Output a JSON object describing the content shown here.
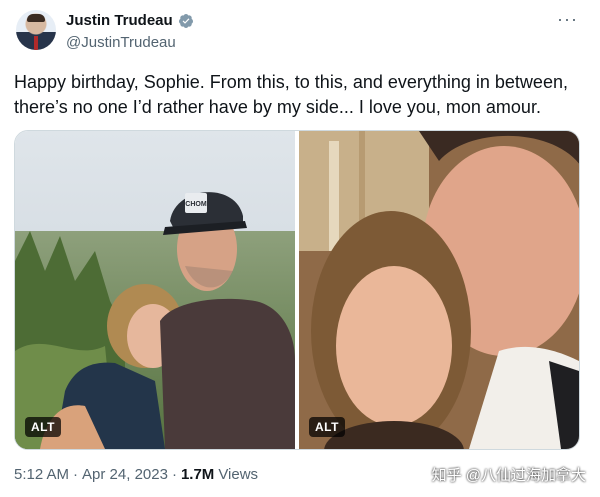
{
  "author": {
    "display_name": "Justin Trudeau",
    "handle": "@JustinTrudeau",
    "verified_icon": "verified-badge-icon"
  },
  "more_menu": {
    "label": "···",
    "icon": "more-options-icon"
  },
  "tweet": {
    "text": "Happy birthday, Sophie. From this, to this, and everything in between, there’s no one I’d rather have by my side... I love you, mon amour."
  },
  "media": {
    "photos": [
      {
        "alt_badge": "ALT",
        "cap_text": "CHOM"
      },
      {
        "alt_badge": "ALT"
      }
    ]
  },
  "meta": {
    "time": "5:12 AM",
    "separator1": "·",
    "date": "Apr 24, 2023",
    "separator2": "·",
    "views_count": "1.7M",
    "views_label": "Views"
  },
  "watermark": "知乎 @八仙过海加拿大",
  "colors": {
    "verified": "#829aab",
    "text_primary": "#0f1419",
    "text_secondary": "#536471",
    "border": "#cfd9de"
  }
}
